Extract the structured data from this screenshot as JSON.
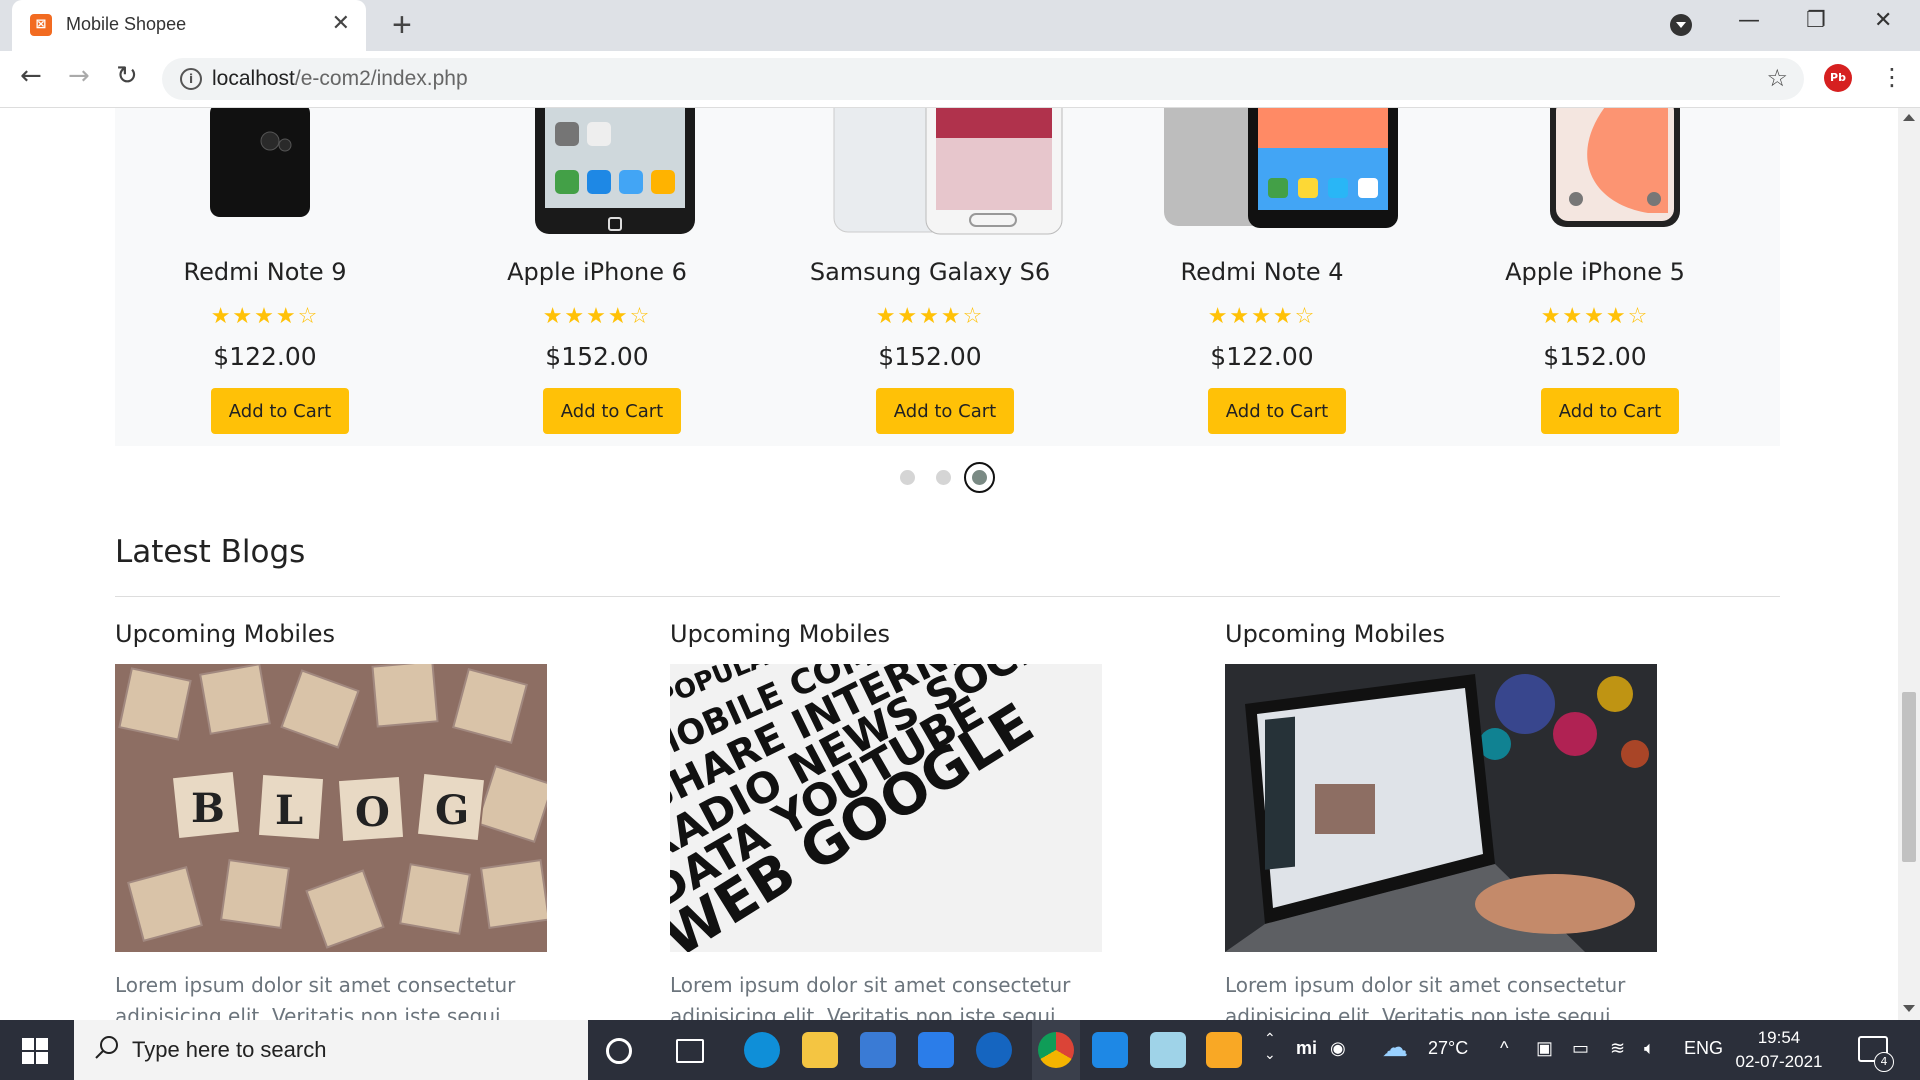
{
  "browser": {
    "tab_title": "Mobile Shopee",
    "url_host": "localhost",
    "url_path": "/e-com2/index.php"
  },
  "products": [
    {
      "name": "Redmi Note 9",
      "price": "$122.00",
      "rating": 4,
      "button": "Add to Cart"
    },
    {
      "name": "Apple iPhone 6",
      "price": "$152.00",
      "rating": 4,
      "button": "Add to Cart"
    },
    {
      "name": "Samsung Galaxy S6",
      "price": "$152.00",
      "rating": 4,
      "button": "Add to Cart"
    },
    {
      "name": "Redmi Note 4",
      "price": "$122.00",
      "rating": 4,
      "button": "Add to Cart"
    },
    {
      "name": "Apple iPhone 5",
      "price": "$152.00",
      "rating": 4,
      "button": "Add to Cart"
    }
  ],
  "carousel": {
    "pages": 3,
    "active_page": 3
  },
  "blogs": {
    "heading": "Latest Blogs",
    "items": [
      {
        "title": "Upcoming Mobiles",
        "text": "Lorem ipsum dolor sit amet consectetur adipisicing elit. Veritatis non iste sequi",
        "image_text": "BLOG"
      },
      {
        "title": "Upcoming Mobiles",
        "text": "Lorem ipsum dolor sit amet consectetur adipisicing elit. Veritatis non iste sequi",
        "image_text": ""
      },
      {
        "title": "Upcoming Mobiles",
        "text": "Lorem ipsum dolor sit amet consectetur adipisicing elit. Veritatis non iste sequi",
        "image_text": ""
      }
    ]
  },
  "taskbar": {
    "search_placeholder": "Type here to search",
    "temperature": "27°C",
    "language": "ENG",
    "time": "19:54",
    "date": "02-07-2021",
    "notification_count": "4"
  },
  "colors": {
    "accent": "#ffc107",
    "taskbar": "#2b2f3a"
  }
}
